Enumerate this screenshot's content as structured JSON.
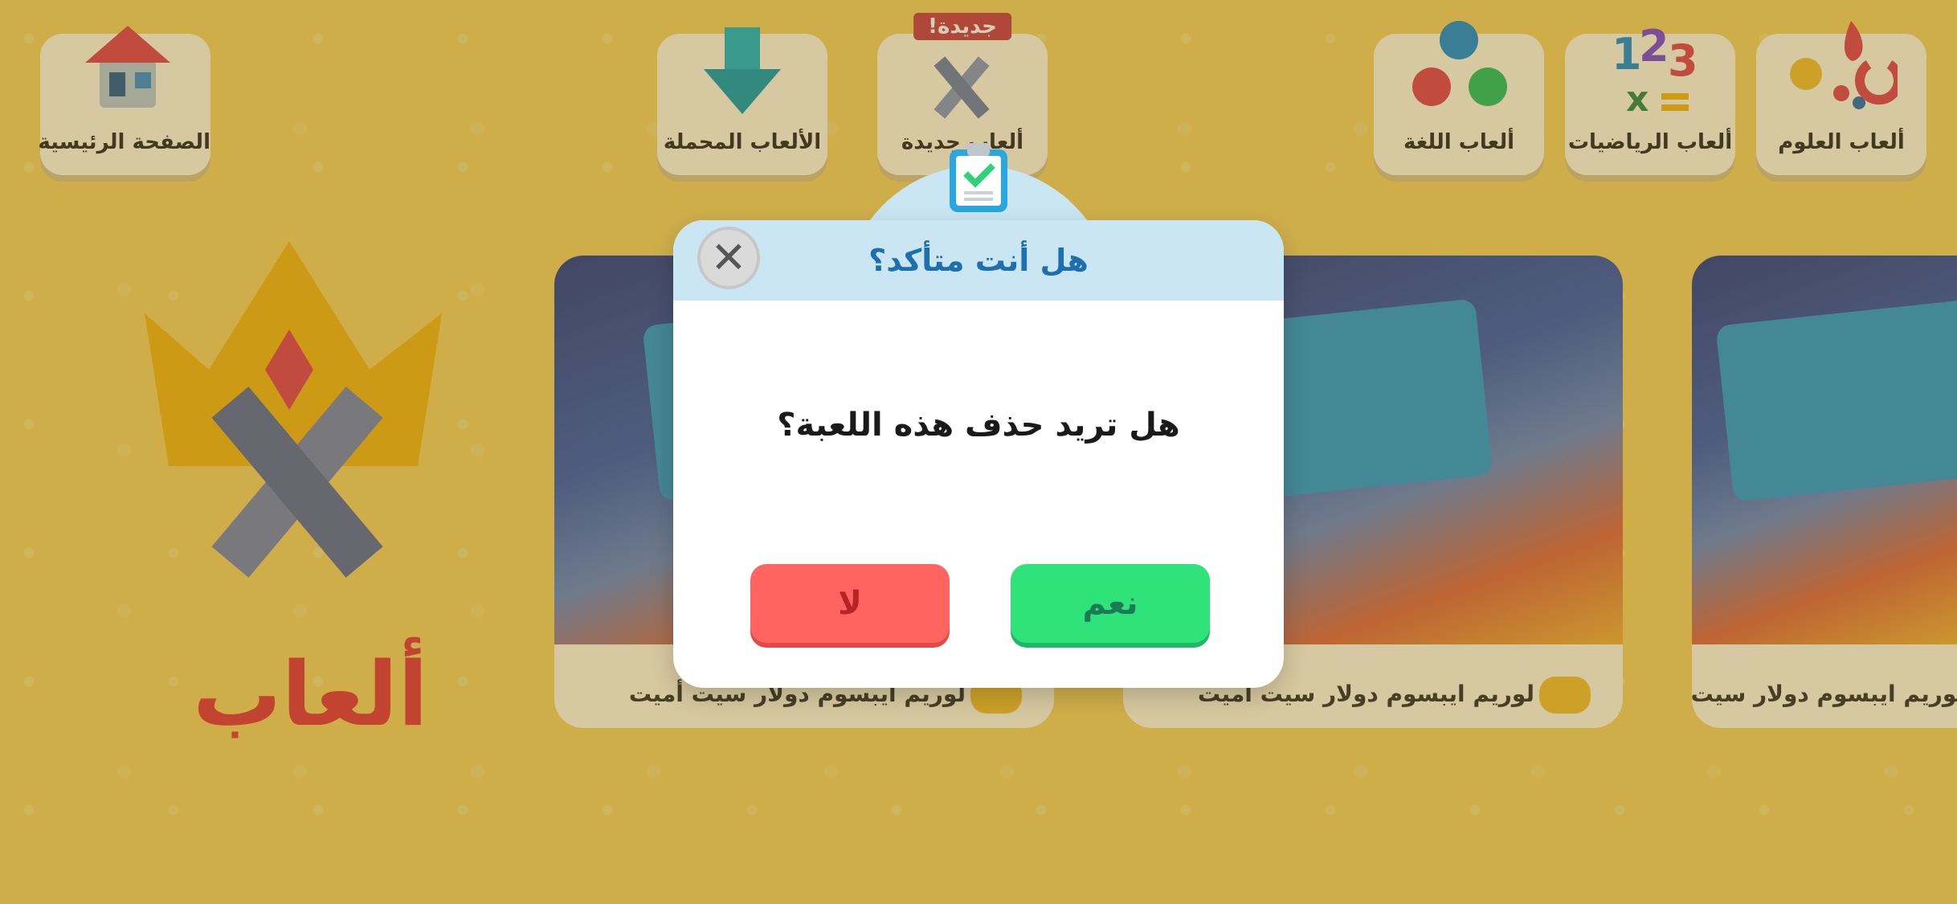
{
  "nav": {
    "home_label": "الصفحة الرئيسية",
    "downloaded_label": "الألعاب المحملة",
    "new_label": "ألعاب جديدة",
    "new_badge": "جديدة!",
    "language_label": "ألعاب اللغة",
    "math_label": "ألعاب الرياضيات",
    "science_label": "ألعاب العلوم"
  },
  "main": {
    "section_title": "ألعاب",
    "cards": [
      {
        "title": "لوريم ايبسوم دولار سيت أميت"
      },
      {
        "title": "لوريم ايبسوم دولار سيت أميت"
      },
      {
        "title": "لوريم ايبسوم دولار سيت أميت"
      }
    ]
  },
  "dialog": {
    "title": "هل أنت متأكد؟",
    "message": "هل تريد حذف هذه اللعبة؟",
    "yes_label": "نعم",
    "no_label": "لا",
    "close_glyph": "✕"
  },
  "icons": {
    "home": "house-icon",
    "download": "download-arrow-icon",
    "new": "crossed-swords-icon",
    "language": "letters-icon",
    "math": "numbers-icon",
    "science": "science-icon",
    "clipboard": "clipboard-check-icon",
    "gamepad": "gamepad-icon"
  },
  "colors": {
    "background": "#f5d36a",
    "accent_red": "#e23a46",
    "yes_green": "#2fe27a",
    "no_red": "#ff6461",
    "dialog_header": "#c9e6f2",
    "dialog_title": "#1e6fb0"
  }
}
